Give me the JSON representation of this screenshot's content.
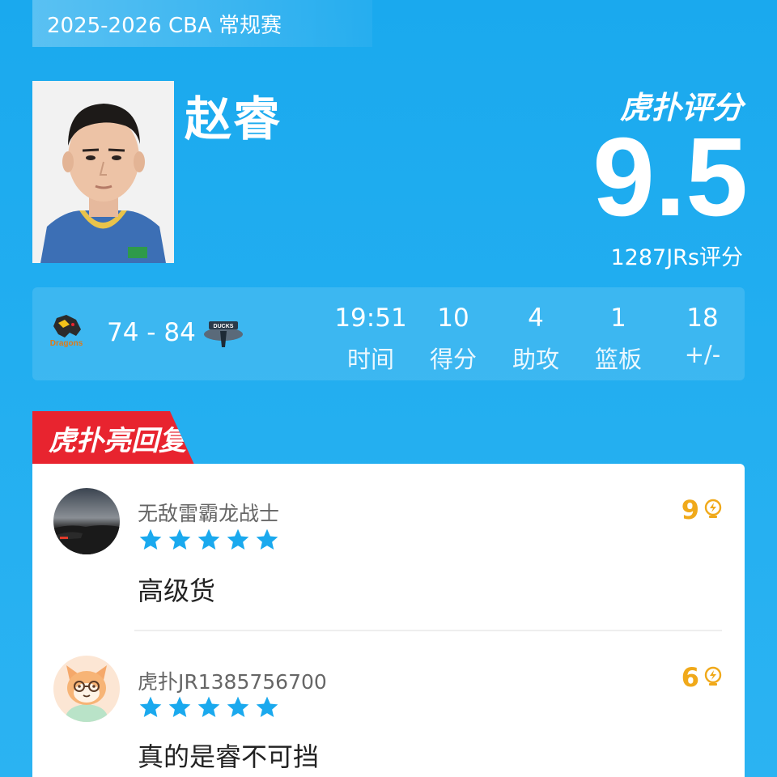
{
  "season": "2025-2026 CBA 常规赛",
  "player": {
    "name": "赵睿"
  },
  "rating": {
    "brand": "虎扑评分",
    "score": "9.5",
    "count": "1287JRs评分"
  },
  "game": {
    "score": "74 - 84",
    "home_logo": "dragons-team-logo-icon",
    "away_logo": "ducks-team-logo-icon",
    "away_logo_text": "DUCKS"
  },
  "stats": [
    {
      "value": "19:51",
      "label": "时间"
    },
    {
      "value": "10",
      "label": "得分"
    },
    {
      "value": "4",
      "label": "助攻"
    },
    {
      "value": "1",
      "label": "篮板"
    },
    {
      "value": "18",
      "label": "+/-"
    }
  ],
  "replies": {
    "tab_label": "虎扑亮回复",
    "items": [
      {
        "username": "无敌雷霸龙战士",
        "stars": 5,
        "text": "高级货",
        "likes": "9"
      },
      {
        "username": "虎扑JR1385756700",
        "stars": 5,
        "text": "真的是睿不可挡",
        "likes": "6"
      }
    ]
  },
  "colors": {
    "background": "#22aef0",
    "tab_red": "#e8242f",
    "star_blue": "#1aa9ee",
    "likes_gold": "#f0a91a"
  }
}
